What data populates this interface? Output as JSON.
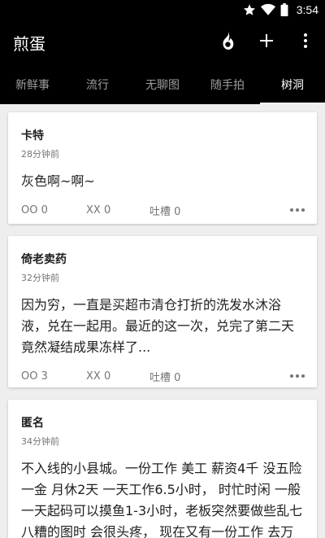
{
  "status_bar": {
    "time": "3:54"
  },
  "app_bar": {
    "title": "煎蛋"
  },
  "tabs": [
    {
      "label": "新鲜事",
      "active": false
    },
    {
      "label": "流行",
      "active": false
    },
    {
      "label": "无聊图",
      "active": false
    },
    {
      "label": "随手拍",
      "active": false
    },
    {
      "label": "树洞",
      "active": true
    }
  ],
  "posts": [
    {
      "author": "卡特",
      "time": "28分钟前",
      "content": "灰色啊~啊~",
      "oo": "OO 0",
      "xx": "XX 0",
      "tucao": "吐槽 0"
    },
    {
      "author": "倚老卖药",
      "time": "32分钟前",
      "content": "因为穷，一直是买超市清仓打折的洗发水沐浴液，兑在一起用。最近的这一次，兑完了第二天竟然凝结成果冻样了...",
      "oo": "OO 3",
      "xx": "XX 0",
      "tucao": "吐槽 0"
    },
    {
      "author": "匿名",
      "time": "34分钟前",
      "content": "不入线的小县城。一份工作 美工 薪资4千 没五险一金 月休2天 一天工作6.5小时， 时忙时闲 一般一天起码可以摸鱼1-3小时，老板突然要做些乱七八糟的图时 会很头疼，  现在又有一份工作  去万"
    }
  ],
  "colors": {
    "app_bar": "#000000",
    "background": "#eeeeee",
    "card": "#ffffff",
    "secondary_text": "#757575"
  }
}
